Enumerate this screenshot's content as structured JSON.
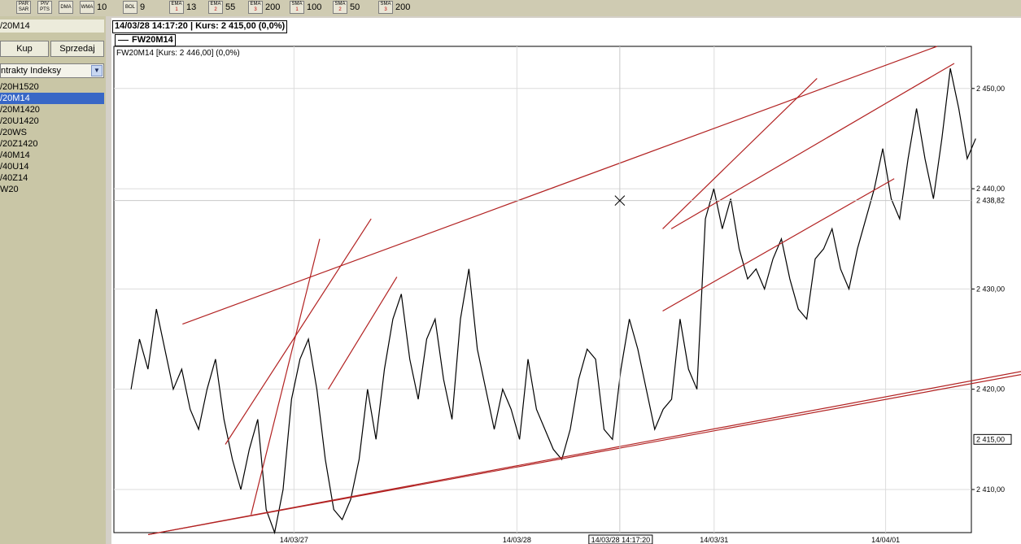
{
  "toolbar": [
    {
      "name": "par-sar",
      "l1": "PAR",
      "l2": "SAR",
      "sub": "",
      "num": ""
    },
    {
      "name": "piv-pts",
      "l1": "PIV",
      "l2": "PTS",
      "sub": "",
      "num": ""
    },
    {
      "name": "dma",
      "l1": "DMA",
      "l2": "",
      "sub": "",
      "num": ""
    },
    {
      "name": "wma",
      "l1": "WMA",
      "l2": "",
      "sub": "",
      "num": "10"
    },
    {
      "name": "bol",
      "l1": "BOL",
      "l2": "",
      "sub": "",
      "num": "9"
    },
    {
      "name": "ema-1",
      "l1": "EMA",
      "l2": "",
      "sub": "1",
      "num": "13"
    },
    {
      "name": "ema-2",
      "l1": "EMA",
      "l2": "",
      "sub": "2",
      "num": "55"
    },
    {
      "name": "ema-3",
      "l1": "EMA",
      "l2": "",
      "sub": "3",
      "num": "200"
    },
    {
      "name": "sma-1",
      "l1": "SMA",
      "l2": "",
      "sub": "1",
      "num": "100"
    },
    {
      "name": "sma-2",
      "l1": "SMA",
      "l2": "",
      "sub": "2",
      "num": "50"
    },
    {
      "name": "sma-3",
      "l1": "SMA",
      "l2": "",
      "sub": "3",
      "num": "200"
    }
  ],
  "left": {
    "instrument": "/20M14",
    "buy": "Kup",
    "sell": "Sprzedaj",
    "category": "ntrakty Indeksy",
    "items": [
      "/20H1520",
      "/20M14",
      "/20M1420",
      "/20U1420",
      "/20WS",
      "/20Z1420",
      "/40M14",
      "/40U14",
      "/40Z14",
      "W20"
    ],
    "selected_index": 1
  },
  "chart": {
    "info": "14/03/28 14:17:20 | Kurs: 2 415,00 (0,0%)",
    "legend": "FW20M14",
    "series_title": "FW20M14 [Kurs: 2 446,00] (0,0%)",
    "crosshair_x_label": "14/03/28 14:17:20",
    "crosshair_y_label": "2 438,82",
    "last_price_label": "2 415,00",
    "line_color": "#000000",
    "trend_color": "#b22222"
  },
  "chart_data": {
    "type": "line",
    "x_tick_labels": [
      "14/03/27",
      "14/03/28",
      "14/03/31",
      "14/04/01"
    ],
    "y_tick_labels": [
      "2 410,00",
      "2 420,00",
      "2 430,00",
      "2 440,00",
      "2 450,00"
    ],
    "y_ticks": [
      2410,
      2420,
      2430,
      2440,
      2450
    ],
    "ylim": [
      2405.7,
      2454.2
    ],
    "crosshair": {
      "x": 0.59,
      "y": 2438.82
    },
    "last_price": 2415.0,
    "series": [
      {
        "x": [
          0,
          0.01,
          0.02,
          0.03,
          0.04,
          0.05,
          0.06,
          0.07,
          0.08,
          0.09,
          0.1,
          0.11,
          0.12,
          0.13,
          0.14,
          0.15,
          0.16,
          0.17,
          0.18,
          0.19,
          0.2,
          0.21,
          0.22,
          0.23,
          0.24,
          0.25,
          0.26,
          0.27,
          0.28,
          0.29,
          0.3,
          0.31,
          0.32,
          0.33,
          0.34,
          0.35,
          0.36,
          0.37,
          0.38,
          0.39,
          0.4,
          0.41,
          0.42,
          0.43,
          0.44,
          0.45,
          0.46,
          0.47,
          0.48,
          0.49,
          0.5,
          0.51,
          0.52,
          0.53,
          0.54,
          0.55,
          0.56,
          0.57,
          0.58,
          0.59,
          0.6,
          0.61,
          0.62,
          0.63,
          0.64,
          0.65,
          0.66,
          0.67,
          0.68,
          0.69,
          0.7,
          0.71,
          0.72,
          0.73,
          0.74,
          0.75,
          0.76,
          0.77,
          0.78,
          0.79,
          0.8,
          0.81,
          0.82,
          0.83,
          0.84,
          0.85,
          0.86,
          0.87,
          0.88,
          0.89,
          0.9,
          0.91,
          0.92,
          0.93,
          0.94,
          0.95,
          0.96,
          0.97,
          0.98,
          0.99,
          1.0
        ],
        "y": [
          2420,
          2425,
          2422,
          2428,
          2424,
          2420,
          2422,
          2418,
          2416,
          2420,
          2423,
          2417,
          2413,
          2410,
          2414,
          2417,
          2408,
          2405.7,
          2410,
          2419,
          2423,
          2425,
          2420,
          2413,
          2408,
          2407,
          2409,
          2413,
          2420,
          2415,
          2422,
          2427,
          2429.5,
          2423,
          2419,
          2425,
          2427,
          2421,
          2417,
          2427,
          2432,
          2424,
          2420,
          2416,
          2420,
          2418,
          2415,
          2423,
          2418,
          2416,
          2414,
          2413,
          2416,
          2421,
          2424,
          2423,
          2416,
          2415,
          2422,
          2427,
          2424,
          2420,
          2416,
          2418,
          2419,
          2427,
          2422,
          2420,
          2437,
          2440,
          2436,
          2439,
          2434,
          2431,
          2432,
          2430,
          2433,
          2435,
          2431,
          2428,
          2427,
          2433,
          2434,
          2436,
          2432,
          2430,
          2434,
          2437,
          2440,
          2444,
          2439,
          2437,
          2443,
          2448,
          2443,
          2439,
          2445,
          2452,
          2448,
          2443,
          2445
        ]
      }
    ],
    "trendlines": [
      {
        "x1": 0.04,
        "y1": 2405.5,
        "x2": 1.06,
        "y2": 2421.5
      },
      {
        "x1": 0.04,
        "y1": 2405.5,
        "x2": 1.06,
        "y2": 2421.8
      },
      {
        "x1": 0.08,
        "y1": 2426.5,
        "x2": 0.96,
        "y2": 2454.2
      },
      {
        "x1": 0.16,
        "y1": 2407.5,
        "x2": 0.24,
        "y2": 2435
      },
      {
        "x1": 0.13,
        "y1": 2414.5,
        "x2": 0.3,
        "y2": 2437
      },
      {
        "x1": 0.25,
        "y1": 2420,
        "x2": 0.33,
        "y2": 2431.2
      },
      {
        "x1": 0.64,
        "y1": 2427.8,
        "x2": 0.91,
        "y2": 2441
      },
      {
        "x1": 0.64,
        "y1": 2436,
        "x2": 0.82,
        "y2": 2451
      },
      {
        "x1": 0.65,
        "y1": 2436,
        "x2": 0.98,
        "y2": 2452.5
      }
    ]
  }
}
